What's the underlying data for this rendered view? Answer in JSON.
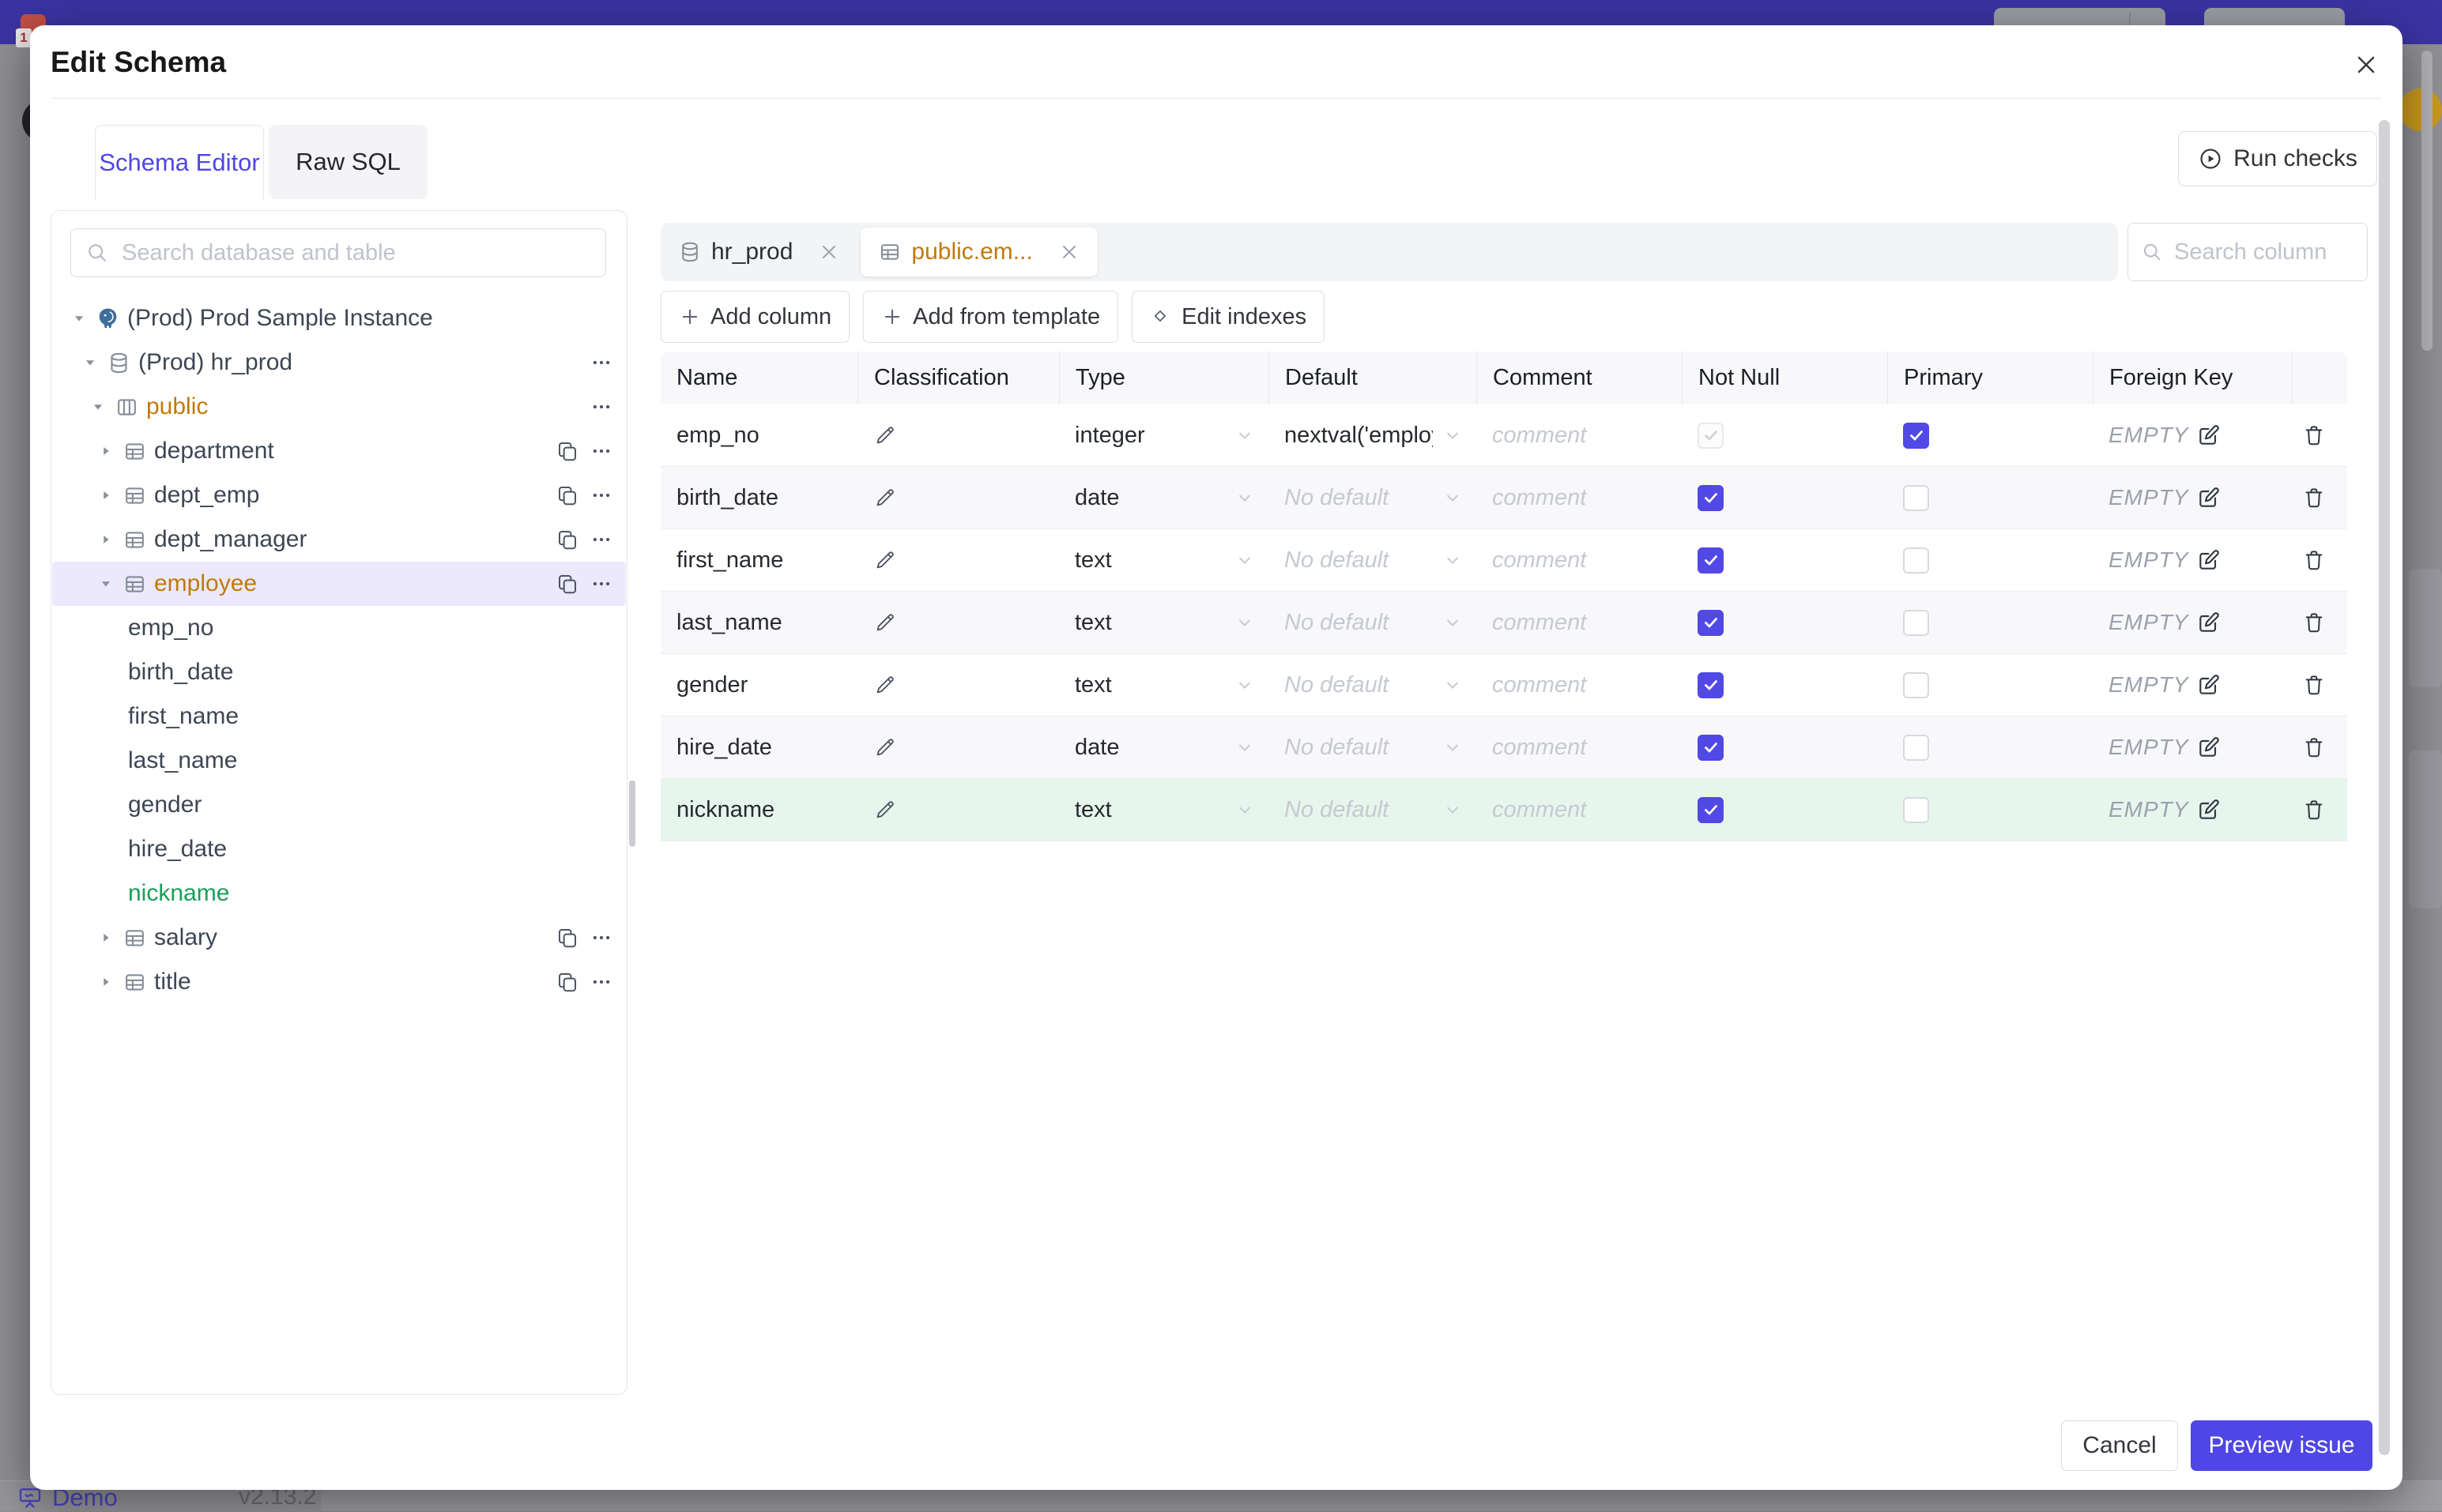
{
  "background": {
    "banner_badge": "1",
    "footer": {
      "demo_label": "Demo",
      "version": "v2.13.2"
    }
  },
  "dialog": {
    "title": "Edit Schema",
    "close_label": "✕",
    "tabs": [
      {
        "label": "Schema Editor",
        "active": true
      },
      {
        "label": "Raw SQL",
        "active": false
      }
    ],
    "run_checks_label": "Run checks",
    "sidebar": {
      "search_placeholder": "Search database and table",
      "tree": [
        {
          "label": "(Prod) Prod Sample Instance",
          "level": 0,
          "icon": "postgres-icon",
          "caret": "down"
        },
        {
          "label": "(Prod) hr_prod",
          "level": 1,
          "icon": "database-icon",
          "caret": "down",
          "menu": true
        },
        {
          "label": "public",
          "level": 2,
          "icon": "schema-icon",
          "caret": "down",
          "menu": true,
          "color": "orange"
        },
        {
          "label": "department",
          "level": 3,
          "icon": "table-icon",
          "caret": "right",
          "copy": true,
          "menu": true
        },
        {
          "label": "dept_emp",
          "level": 3,
          "icon": "table-icon",
          "caret": "right",
          "copy": true,
          "menu": true
        },
        {
          "label": "dept_manager",
          "level": 3,
          "icon": "table-icon",
          "caret": "right",
          "copy": true,
          "menu": true
        },
        {
          "label": "employee",
          "level": 3,
          "icon": "table-icon",
          "caret": "down",
          "copy": true,
          "menu": true,
          "selected": true,
          "color": "orange"
        },
        {
          "label": "emp_no",
          "column": true
        },
        {
          "label": "birth_date",
          "column": true
        },
        {
          "label": "first_name",
          "column": true
        },
        {
          "label": "last_name",
          "column": true
        },
        {
          "label": "gender",
          "column": true
        },
        {
          "label": "hire_date",
          "column": true
        },
        {
          "label": "nickname",
          "column": true,
          "color": "green"
        },
        {
          "label": "salary",
          "level": 3,
          "icon": "table-icon",
          "caret": "right",
          "copy": true,
          "menu": true
        },
        {
          "label": "title",
          "level": 3,
          "icon": "table-icon",
          "caret": "right",
          "copy": true,
          "menu": true
        }
      ]
    },
    "editor": {
      "tabs": [
        {
          "label": "hr_prod",
          "icon": "database-icon",
          "active": false
        },
        {
          "label": "public.em...",
          "icon": "table-icon",
          "active": true
        }
      ],
      "column_search_placeholder": "Search column",
      "toolbar": [
        {
          "label": "Add column",
          "icon": "plus-icon"
        },
        {
          "label": "Add from template",
          "icon": "plus-icon"
        },
        {
          "label": "Edit indexes",
          "icon": "diamond-icon"
        }
      ],
      "table": {
        "headers": [
          "Name",
          "Classification",
          "Type",
          "Default",
          "Comment",
          "Not Null",
          "Primary",
          "Foreign Key"
        ],
        "comment_placeholder": "comment",
        "no_default_placeholder": "No default",
        "foreign_key_placeholder": "EMPTY",
        "rows": [
          {
            "name": "emp_no",
            "type": "integer",
            "default_value": "nextval('employ",
            "not_null": true,
            "not_null_disabled": true,
            "primary": true
          },
          {
            "name": "birth_date",
            "type": "date",
            "default_value": "",
            "not_null": true,
            "primary": false
          },
          {
            "name": "first_name",
            "type": "text",
            "default_value": "",
            "not_null": true,
            "primary": false
          },
          {
            "name": "last_name",
            "type": "text",
            "default_value": "",
            "not_null": true,
            "primary": false
          },
          {
            "name": "gender",
            "type": "text",
            "default_value": "",
            "not_null": true,
            "primary": false
          },
          {
            "name": "hire_date",
            "type": "date",
            "default_value": "",
            "not_null": true,
            "primary": false
          },
          {
            "name": "nickname",
            "type": "text",
            "default_value": "",
            "not_null": true,
            "primary": false,
            "highlight": "green"
          }
        ]
      }
    },
    "footer": {
      "cancel_label": "Cancel",
      "primary_label": "Preview issue"
    }
  },
  "colors": {
    "accent_purple": "#4f46e5",
    "checkbox_purple": "#5148e5",
    "orange_entity": "#c2790c",
    "green_new": "#18a058",
    "selected_row_bg": "#ebe9fb",
    "new_row_bg": "#e7f6ed",
    "banner_purple": "#3a34a3"
  }
}
